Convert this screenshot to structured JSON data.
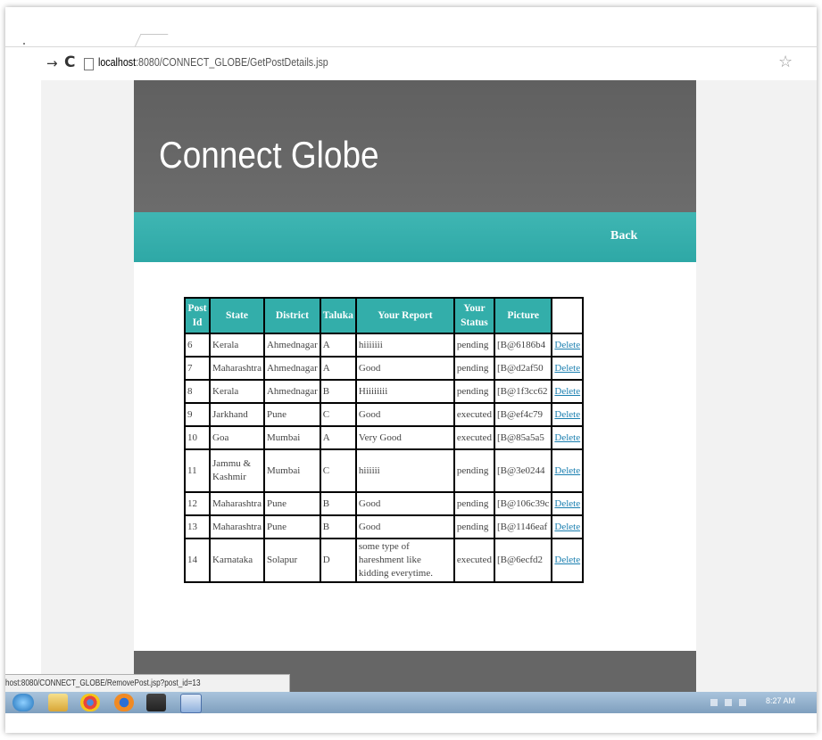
{
  "browser": {
    "url_host": "localhost",
    "url_path": ":8080/CONNECT_GLOBE/GetPostDetails.jsp",
    "forward_glyph": "→",
    "reload_glyph": "C",
    "star_glyph": "☆"
  },
  "site": {
    "title": "Connect Globe",
    "back_label": "Back"
  },
  "table": {
    "headers": [
      "Post Id",
      "State",
      "District",
      "Taluka",
      "Your Report",
      "Your Status",
      "Picture",
      ""
    ],
    "rows": [
      {
        "id": "6",
        "state": "Kerala",
        "district": "Ahmednagar",
        "taluka": "A",
        "report": "hiiiiiii",
        "status": "pending",
        "picture": "[B@6186b4",
        "action": "Delete"
      },
      {
        "id": "7",
        "state": "Maharashtra",
        "district": "Ahmednagar",
        "taluka": "A",
        "report": "Good",
        "status": "pending",
        "picture": "[B@d2af50",
        "action": "Delete"
      },
      {
        "id": "8",
        "state": "Kerala",
        "district": "Ahmednagar",
        "taluka": "B",
        "report": "Hiiiiiiii",
        "status": "pending",
        "picture": "[B@1f3cc62",
        "action": "Delete"
      },
      {
        "id": "9",
        "state": "Jarkhand",
        "district": "Pune",
        "taluka": "C",
        "report": "Good",
        "status": "executed",
        "picture": "[B@ef4c79",
        "action": "Delete"
      },
      {
        "id": "10",
        "state": "Goa",
        "district": "Mumbai",
        "taluka": "A",
        "report": "Very Good",
        "status": "executed",
        "picture": "[B@85a5a5",
        "action": "Delete"
      },
      {
        "id": "11",
        "state": "Jammu & Kashmir",
        "district": "Mumbai",
        "taluka": "C",
        "report": "hiiiiii",
        "status": "pending",
        "picture": "[B@3e0244",
        "action": "Delete"
      },
      {
        "id": "12",
        "state": "Maharashtra",
        "district": "Pune",
        "taluka": "B",
        "report": "Good",
        "status": "pending",
        "picture": "[B@106c39c",
        "action": "Delete"
      },
      {
        "id": "13",
        "state": "Maharashtra",
        "district": "Pune",
        "taluka": "B",
        "report": "Good",
        "status": "pending",
        "picture": "[B@1146eaf",
        "action": "Delete"
      },
      {
        "id": "14",
        "state": "Karnataka",
        "district": "Solapur",
        "taluka": "D",
        "report": "some type of hareshment like kidding everytime.",
        "status": "executed",
        "picture": "[B@6ecfd2",
        "action": "Delete"
      }
    ]
  },
  "statusbar": {
    "text": "host:8080/CONNECT_GLOBE/RemovePost.jsp?post_id=13"
  },
  "taskbar": {
    "clock": "8:27 AM",
    "icons": [
      "start-orb-icon",
      "folder-icon",
      "chrome-icon",
      "firefox-icon",
      "media-icon",
      "word-icon"
    ]
  }
}
